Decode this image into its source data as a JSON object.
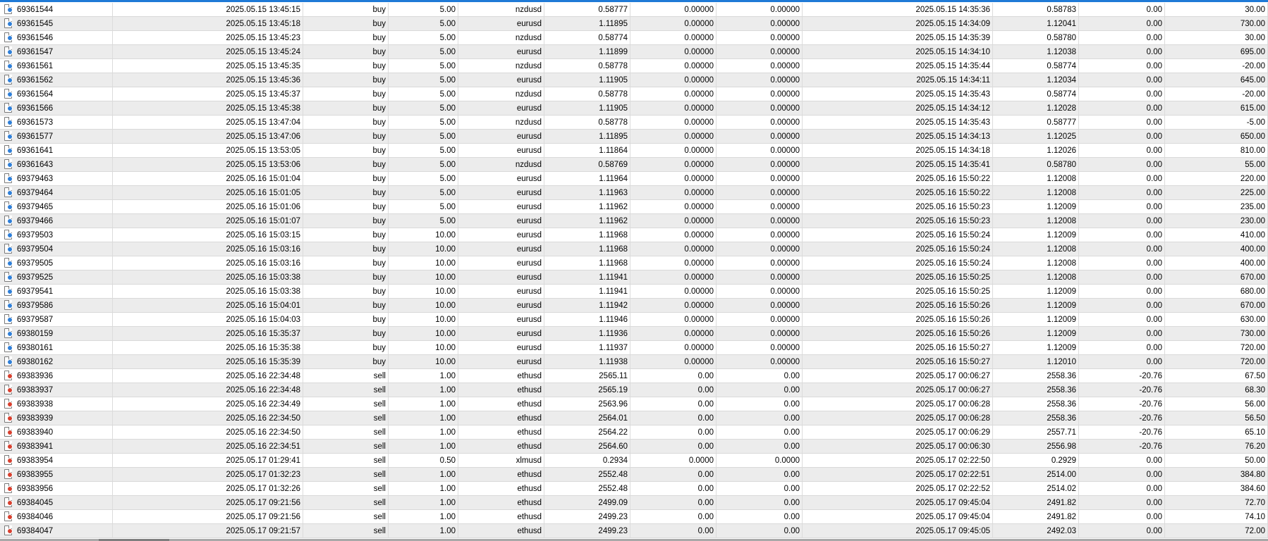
{
  "colors": {
    "buy_icon": "#2f7fd8",
    "sell_icon": "#d8402f",
    "selection_bar": "#1f7ad6"
  },
  "rows": [
    {
      "ticket": "69361544",
      "open_time": "2025.05.15 13:45:15",
      "type": "buy",
      "volume": "5.00",
      "symbol": "nzdusd",
      "price": "0.58777",
      "sl": "0.00000",
      "tp": "0.00000",
      "close_time": "2025.05.15 14:35:36",
      "close_price": "0.58783",
      "swap": "0.00",
      "profit": "30.00"
    },
    {
      "ticket": "69361545",
      "open_time": "2025.05.15 13:45:18",
      "type": "buy",
      "volume": "5.00",
      "symbol": "eurusd",
      "price": "1.11895",
      "sl": "0.00000",
      "tp": "0.00000",
      "close_time": "2025.05.15 14:34:09",
      "close_price": "1.12041",
      "swap": "0.00",
      "profit": "730.00"
    },
    {
      "ticket": "69361546",
      "open_time": "2025.05.15 13:45:23",
      "type": "buy",
      "volume": "5.00",
      "symbol": "nzdusd",
      "price": "0.58774",
      "sl": "0.00000",
      "tp": "0.00000",
      "close_time": "2025.05.15 14:35:39",
      "close_price": "0.58780",
      "swap": "0.00",
      "profit": "30.00"
    },
    {
      "ticket": "69361547",
      "open_time": "2025.05.15 13:45:24",
      "type": "buy",
      "volume": "5.00",
      "symbol": "eurusd",
      "price": "1.11899",
      "sl": "0.00000",
      "tp": "0.00000",
      "close_time": "2025.05.15 14:34:10",
      "close_price": "1.12038",
      "swap": "0.00",
      "profit": "695.00"
    },
    {
      "ticket": "69361561",
      "open_time": "2025.05.15 13:45:35",
      "type": "buy",
      "volume": "5.00",
      "symbol": "nzdusd",
      "price": "0.58778",
      "sl": "0.00000",
      "tp": "0.00000",
      "close_time": "2025.05.15 14:35:44",
      "close_price": "0.58774",
      "swap": "0.00",
      "profit": "-20.00"
    },
    {
      "ticket": "69361562",
      "open_time": "2025.05.15 13:45:36",
      "type": "buy",
      "volume": "5.00",
      "symbol": "eurusd",
      "price": "1.11905",
      "sl": "0.00000",
      "tp": "0.00000",
      "close_time": "2025.05.15 14:34:11",
      "close_price": "1.12034",
      "swap": "0.00",
      "profit": "645.00"
    },
    {
      "ticket": "69361564",
      "open_time": "2025.05.15 13:45:37",
      "type": "buy",
      "volume": "5.00",
      "symbol": "nzdusd",
      "price": "0.58778",
      "sl": "0.00000",
      "tp": "0.00000",
      "close_time": "2025.05.15 14:35:43",
      "close_price": "0.58774",
      "swap": "0.00",
      "profit": "-20.00"
    },
    {
      "ticket": "69361566",
      "open_time": "2025.05.15 13:45:38",
      "type": "buy",
      "volume": "5.00",
      "symbol": "eurusd",
      "price": "1.11905",
      "sl": "0.00000",
      "tp": "0.00000",
      "close_time": "2025.05.15 14:34:12",
      "close_price": "1.12028",
      "swap": "0.00",
      "profit": "615.00"
    },
    {
      "ticket": "69361573",
      "open_time": "2025.05.15 13:47:04",
      "type": "buy",
      "volume": "5.00",
      "symbol": "nzdusd",
      "price": "0.58778",
      "sl": "0.00000",
      "tp": "0.00000",
      "close_time": "2025.05.15 14:35:43",
      "close_price": "0.58777",
      "swap": "0.00",
      "profit": "-5.00"
    },
    {
      "ticket": "69361577",
      "open_time": "2025.05.15 13:47:06",
      "type": "buy",
      "volume": "5.00",
      "symbol": "eurusd",
      "price": "1.11895",
      "sl": "0.00000",
      "tp": "0.00000",
      "close_time": "2025.05.15 14:34:13",
      "close_price": "1.12025",
      "swap": "0.00",
      "profit": "650.00"
    },
    {
      "ticket": "69361641",
      "open_time": "2025.05.15 13:53:05",
      "type": "buy",
      "volume": "5.00",
      "symbol": "eurusd",
      "price": "1.11864",
      "sl": "0.00000",
      "tp": "0.00000",
      "close_time": "2025.05.15 14:34:18",
      "close_price": "1.12026",
      "swap": "0.00",
      "profit": "810.00"
    },
    {
      "ticket": "69361643",
      "open_time": "2025.05.15 13:53:06",
      "type": "buy",
      "volume": "5.00",
      "symbol": "nzdusd",
      "price": "0.58769",
      "sl": "0.00000",
      "tp": "0.00000",
      "close_time": "2025.05.15 14:35:41",
      "close_price": "0.58780",
      "swap": "0.00",
      "profit": "55.00"
    },
    {
      "ticket": "69379463",
      "open_time": "2025.05.16 15:01:04",
      "type": "buy",
      "volume": "5.00",
      "symbol": "eurusd",
      "price": "1.11964",
      "sl": "0.00000",
      "tp": "0.00000",
      "close_time": "2025.05.16 15:50:22",
      "close_price": "1.12008",
      "swap": "0.00",
      "profit": "220.00"
    },
    {
      "ticket": "69379464",
      "open_time": "2025.05.16 15:01:05",
      "type": "buy",
      "volume": "5.00",
      "symbol": "eurusd",
      "price": "1.11963",
      "sl": "0.00000",
      "tp": "0.00000",
      "close_time": "2025.05.16 15:50:22",
      "close_price": "1.12008",
      "swap": "0.00",
      "profit": "225.00"
    },
    {
      "ticket": "69379465",
      "open_time": "2025.05.16 15:01:06",
      "type": "buy",
      "volume": "5.00",
      "symbol": "eurusd",
      "price": "1.11962",
      "sl": "0.00000",
      "tp": "0.00000",
      "close_time": "2025.05.16 15:50:23",
      "close_price": "1.12009",
      "swap": "0.00",
      "profit": "235.00"
    },
    {
      "ticket": "69379466",
      "open_time": "2025.05.16 15:01:07",
      "type": "buy",
      "volume": "5.00",
      "symbol": "eurusd",
      "price": "1.11962",
      "sl": "0.00000",
      "tp": "0.00000",
      "close_time": "2025.05.16 15:50:23",
      "close_price": "1.12008",
      "swap": "0.00",
      "profit": "230.00"
    },
    {
      "ticket": "69379503",
      "open_time": "2025.05.16 15:03:15",
      "type": "buy",
      "volume": "10.00",
      "symbol": "eurusd",
      "price": "1.11968",
      "sl": "0.00000",
      "tp": "0.00000",
      "close_time": "2025.05.16 15:50:24",
      "close_price": "1.12009",
      "swap": "0.00",
      "profit": "410.00"
    },
    {
      "ticket": "69379504",
      "open_time": "2025.05.16 15:03:16",
      "type": "buy",
      "volume": "10.00",
      "symbol": "eurusd",
      "price": "1.11968",
      "sl": "0.00000",
      "tp": "0.00000",
      "close_time": "2025.05.16 15:50:24",
      "close_price": "1.12008",
      "swap": "0.00",
      "profit": "400.00"
    },
    {
      "ticket": "69379505",
      "open_time": "2025.05.16 15:03:16",
      "type": "buy",
      "volume": "10.00",
      "symbol": "eurusd",
      "price": "1.11968",
      "sl": "0.00000",
      "tp": "0.00000",
      "close_time": "2025.05.16 15:50:24",
      "close_price": "1.12008",
      "swap": "0.00",
      "profit": "400.00"
    },
    {
      "ticket": "69379525",
      "open_time": "2025.05.16 15:03:38",
      "type": "buy",
      "volume": "10.00",
      "symbol": "eurusd",
      "price": "1.11941",
      "sl": "0.00000",
      "tp": "0.00000",
      "close_time": "2025.05.16 15:50:25",
      "close_price": "1.12008",
      "swap": "0.00",
      "profit": "670.00"
    },
    {
      "ticket": "69379541",
      "open_time": "2025.05.16 15:03:38",
      "type": "buy",
      "volume": "10.00",
      "symbol": "eurusd",
      "price": "1.11941",
      "sl": "0.00000",
      "tp": "0.00000",
      "close_time": "2025.05.16 15:50:25",
      "close_price": "1.12009",
      "swap": "0.00",
      "profit": "680.00"
    },
    {
      "ticket": "69379586",
      "open_time": "2025.05.16 15:04:01",
      "type": "buy",
      "volume": "10.00",
      "symbol": "eurusd",
      "price": "1.11942",
      "sl": "0.00000",
      "tp": "0.00000",
      "close_time": "2025.05.16 15:50:26",
      "close_price": "1.12009",
      "swap": "0.00",
      "profit": "670.00"
    },
    {
      "ticket": "69379587",
      "open_time": "2025.05.16 15:04:03",
      "type": "buy",
      "volume": "10.00",
      "symbol": "eurusd",
      "price": "1.11946",
      "sl": "0.00000",
      "tp": "0.00000",
      "close_time": "2025.05.16 15:50:26",
      "close_price": "1.12009",
      "swap": "0.00",
      "profit": "630.00"
    },
    {
      "ticket": "69380159",
      "open_time": "2025.05.16 15:35:37",
      "type": "buy",
      "volume": "10.00",
      "symbol": "eurusd",
      "price": "1.11936",
      "sl": "0.00000",
      "tp": "0.00000",
      "close_time": "2025.05.16 15:50:26",
      "close_price": "1.12009",
      "swap": "0.00",
      "profit": "730.00"
    },
    {
      "ticket": "69380161",
      "open_time": "2025.05.16 15:35:38",
      "type": "buy",
      "volume": "10.00",
      "symbol": "eurusd",
      "price": "1.11937",
      "sl": "0.00000",
      "tp": "0.00000",
      "close_time": "2025.05.16 15:50:27",
      "close_price": "1.12009",
      "swap": "0.00",
      "profit": "720.00"
    },
    {
      "ticket": "69380162",
      "open_time": "2025.05.16 15:35:39",
      "type": "buy",
      "volume": "10.00",
      "symbol": "eurusd",
      "price": "1.11938",
      "sl": "0.00000",
      "tp": "0.00000",
      "close_time": "2025.05.16 15:50:27",
      "close_price": "1.12010",
      "swap": "0.00",
      "profit": "720.00"
    },
    {
      "ticket": "69383936",
      "open_time": "2025.05.16 22:34:48",
      "type": "sell",
      "volume": "1.00",
      "symbol": "ethusd",
      "price": "2565.11",
      "sl": "0.00",
      "tp": "0.00",
      "close_time": "2025.05.17 00:06:27",
      "close_price": "2558.36",
      "swap": "-20.76",
      "profit": "67.50"
    },
    {
      "ticket": "69383937",
      "open_time": "2025.05.16 22:34:48",
      "type": "sell",
      "volume": "1.00",
      "symbol": "ethusd",
      "price": "2565.19",
      "sl": "0.00",
      "tp": "0.00",
      "close_time": "2025.05.17 00:06:27",
      "close_price": "2558.36",
      "swap": "-20.76",
      "profit": "68.30"
    },
    {
      "ticket": "69383938",
      "open_time": "2025.05.16 22:34:49",
      "type": "sell",
      "volume": "1.00",
      "symbol": "ethusd",
      "price": "2563.96",
      "sl": "0.00",
      "tp": "0.00",
      "close_time": "2025.05.17 00:06:28",
      "close_price": "2558.36",
      "swap": "-20.76",
      "profit": "56.00"
    },
    {
      "ticket": "69383939",
      "open_time": "2025.05.16 22:34:50",
      "type": "sell",
      "volume": "1.00",
      "symbol": "ethusd",
      "price": "2564.01",
      "sl": "0.00",
      "tp": "0.00",
      "close_time": "2025.05.17 00:06:28",
      "close_price": "2558.36",
      "swap": "-20.76",
      "profit": "56.50"
    },
    {
      "ticket": "69383940",
      "open_time": "2025.05.16 22:34:50",
      "type": "sell",
      "volume": "1.00",
      "symbol": "ethusd",
      "price": "2564.22",
      "sl": "0.00",
      "tp": "0.00",
      "close_time": "2025.05.17 00:06:29",
      "close_price": "2557.71",
      "swap": "-20.76",
      "profit": "65.10"
    },
    {
      "ticket": "69383941",
      "open_time": "2025.05.16 22:34:51",
      "type": "sell",
      "volume": "1.00",
      "symbol": "ethusd",
      "price": "2564.60",
      "sl": "0.00",
      "tp": "0.00",
      "close_time": "2025.05.17 00:06:30",
      "close_price": "2556.98",
      "swap": "-20.76",
      "profit": "76.20"
    },
    {
      "ticket": "69383954",
      "open_time": "2025.05.17 01:29:41",
      "type": "sell",
      "volume": "0.50",
      "symbol": "xlmusd",
      "price": "0.2934",
      "sl": "0.0000",
      "tp": "0.0000",
      "close_time": "2025.05.17 02:22:50",
      "close_price": "0.2929",
      "swap": "0.00",
      "profit": "50.00"
    },
    {
      "ticket": "69383955",
      "open_time": "2025.05.17 01:32:23",
      "type": "sell",
      "volume": "1.00",
      "symbol": "ethusd",
      "price": "2552.48",
      "sl": "0.00",
      "tp": "0.00",
      "close_time": "2025.05.17 02:22:51",
      "close_price": "2514.00",
      "swap": "0.00",
      "profit": "384.80"
    },
    {
      "ticket": "69383956",
      "open_time": "2025.05.17 01:32:26",
      "type": "sell",
      "volume": "1.00",
      "symbol": "ethusd",
      "price": "2552.48",
      "sl": "0.00",
      "tp": "0.00",
      "close_time": "2025.05.17 02:22:52",
      "close_price": "2514.02",
      "swap": "0.00",
      "profit": "384.60"
    },
    {
      "ticket": "69384045",
      "open_time": "2025.05.17 09:21:56",
      "type": "sell",
      "volume": "1.00",
      "symbol": "ethusd",
      "price": "2499.09",
      "sl": "0.00",
      "tp": "0.00",
      "close_time": "2025.05.17 09:45:04",
      "close_price": "2491.82",
      "swap": "0.00",
      "profit": "72.70"
    },
    {
      "ticket": "69384046",
      "open_time": "2025.05.17 09:21:56",
      "type": "sell",
      "volume": "1.00",
      "symbol": "ethusd",
      "price": "2499.23",
      "sl": "0.00",
      "tp": "0.00",
      "close_time": "2025.05.17 09:45:04",
      "close_price": "2491.82",
      "swap": "0.00",
      "profit": "74.10"
    },
    {
      "ticket": "69384047",
      "open_time": "2025.05.17 09:21:57",
      "type": "sell",
      "volume": "1.00",
      "symbol": "ethusd",
      "price": "2499.23",
      "sl": "0.00",
      "tp": "0.00",
      "close_time": "2025.05.17 09:45:05",
      "close_price": "2492.03",
      "swap": "0.00",
      "profit": "72.00"
    }
  ]
}
